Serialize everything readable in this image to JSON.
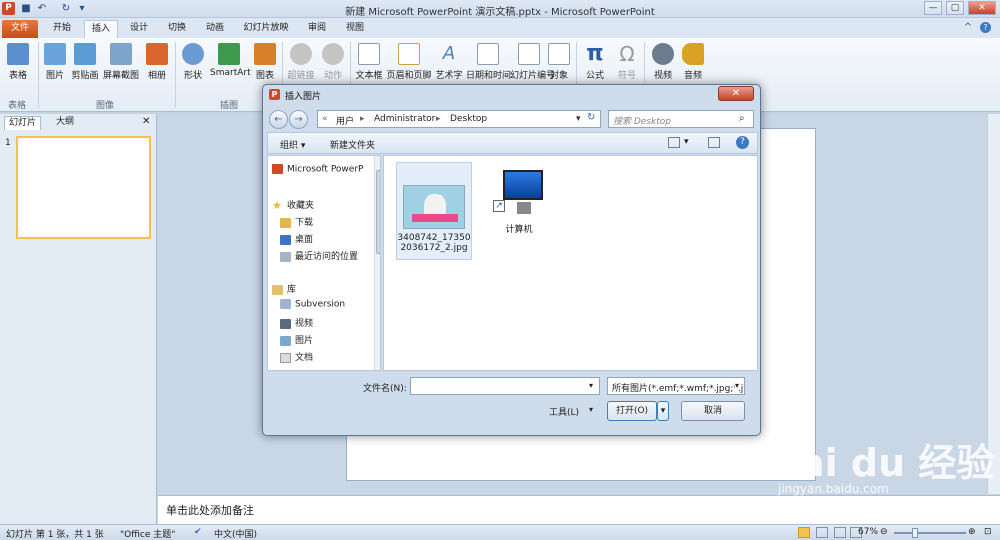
{
  "window": {
    "title": "新建 Microsoft PowerPoint 演示文稿.pptx - Microsoft PowerPoint",
    "app_letter": "P",
    "btn_min": "—",
    "btn_max": "▢",
    "btn_close": "✕"
  },
  "tabs": [
    "文件",
    "开始",
    "插入",
    "设计",
    "切换",
    "动画",
    "幻灯片放映",
    "审阅",
    "视图"
  ],
  "ribbon": {
    "buttons": [
      {
        "label": "表格",
        "color": "#5b8fd0"
      },
      {
        "label": "图片",
        "color": "#6aa5d9"
      },
      {
        "label": "剪贴画",
        "color": "#5c9bd6"
      },
      {
        "label": "屏幕截图",
        "color": "#7fa4cc"
      },
      {
        "label": "相册",
        "color": "#d9662c"
      },
      {
        "label": "形状",
        "color": "#6b9ad3"
      },
      {
        "label": "SmartArt",
        "color": "#3d9a4e"
      },
      {
        "label": "图表",
        "color": "#d8812b"
      },
      {
        "label": "超链接",
        "color": "#b5b5b5"
      },
      {
        "label": "动作",
        "color": "#b5b5b5"
      },
      {
        "label": "文本框",
        "color": "#8c9bb0"
      },
      {
        "label": "页眉和页脚",
        "color": "#c9a14a"
      },
      {
        "label": "艺术字",
        "color": "#4f7fc6"
      },
      {
        "label": "日期和时间",
        "color": "#8d9cb5"
      },
      {
        "label": "幻灯片编号",
        "color": "#8d9cb5"
      },
      {
        "label": "对象",
        "color": "#8d9cb5"
      },
      {
        "label": "公式",
        "color": "#2c5ea8"
      },
      {
        "label": "符号",
        "color": "#9a9a9a"
      },
      {
        "label": "视频",
        "color": "#6d7b8e"
      },
      {
        "label": "音频",
        "color": "#d9a227"
      }
    ],
    "groups": [
      "表格",
      "图像",
      "插图"
    ]
  },
  "leftpane": {
    "tab_slides": "幻灯片",
    "tab_outline": "大纲",
    "close": "✕",
    "slide_number": "1"
  },
  "notes": {
    "placeholder": "单击此处添加备注"
  },
  "status": {
    "slide_info": "幻灯片 第 1 张，共 1 张",
    "theme": "\"Office 主题\"",
    "language": "中文(中国)",
    "zoom": "67%"
  },
  "dialog": {
    "title": "插入图片",
    "close": "✕",
    "path": [
      "用户",
      "Administrator",
      "Desktop"
    ],
    "search_placeholder": "搜索 Desktop",
    "organize": "组织 ▾",
    "new_folder": "新建文件夹",
    "nav": {
      "items": [
        {
          "label": "Microsoft PowerP",
          "color": "#d24726"
        },
        {
          "label": "收藏夹",
          "color": "#e8b840"
        },
        {
          "label": "下载",
          "color": "#e0b650"
        },
        {
          "label": "桌面",
          "color": "#3a74c4"
        },
        {
          "label": "最近访问的位置",
          "color": "#a6b4c6"
        },
        {
          "label": "库",
          "color": "#e3c06a"
        },
        {
          "label": "Subversion",
          "color": "#9fb3cc"
        },
        {
          "label": "视频",
          "color": "#5a6a7e"
        },
        {
          "label": "图片",
          "color": "#7ea7cf"
        },
        {
          "label": "文档",
          "color": "#d8dde4"
        }
      ]
    },
    "files": [
      {
        "name": "3408742_173502036172_2.jpg",
        "line1": "3408742_17350",
        "line2": "2036172_2.jpg"
      },
      {
        "name": "计算机",
        "line1": "计算机",
        "line2": ""
      }
    ],
    "filename_label": "文件名(N):",
    "filename_value": "",
    "filetype_value": "所有图片(*.emf;*.wmf;*.jpg;*.ji",
    "tools": "工具(L)",
    "open": "打开(O)",
    "cancel": "取消"
  },
  "watermark": {
    "text": "Bai du 经验",
    "url": "jingyan.baidu.com"
  }
}
